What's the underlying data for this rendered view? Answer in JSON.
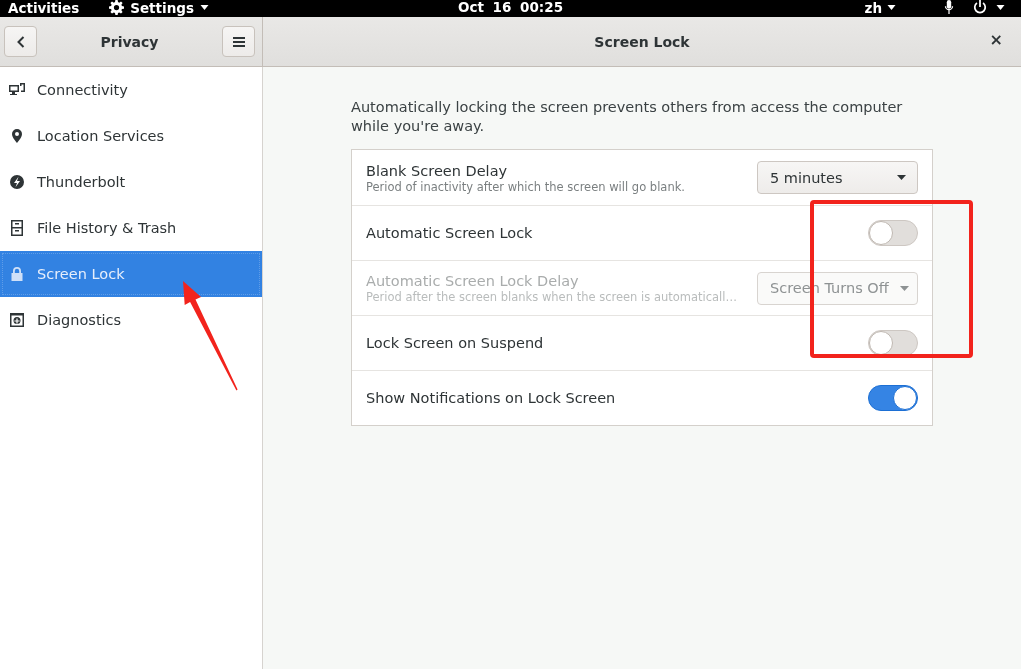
{
  "top_bar": {
    "activities": "Activities",
    "app_menu": "Settings",
    "clock": "Oct 16 00:25",
    "input_source": "zh"
  },
  "sidebar": {
    "title": "Privacy",
    "items": [
      {
        "label": "Connectivity",
        "selected": false
      },
      {
        "label": "Location Services",
        "selected": false
      },
      {
        "label": "Thunderbolt",
        "selected": false
      },
      {
        "label": "File History & Trash",
        "selected": false
      },
      {
        "label": "Screen Lock",
        "selected": true
      },
      {
        "label": "Diagnostics",
        "selected": false
      }
    ]
  },
  "panel": {
    "title": "Screen Lock",
    "close": "×",
    "description": "Automatically locking the screen prevents others from access the computer while you're away.",
    "rows": [
      {
        "kind": "dropdown",
        "title": "Blank Screen Delay",
        "subtitle": "Period of inactivity after which the screen will go blank.",
        "value": "5 minutes",
        "disabled": false
      },
      {
        "kind": "switch",
        "title": "Automatic Screen Lock",
        "on": false,
        "disabled": false
      },
      {
        "kind": "dropdown",
        "title": "Automatic Screen Lock Delay",
        "subtitle": "Period after the screen blanks when the screen is automaticall…",
        "value": "Screen Turns Off",
        "disabled": true
      },
      {
        "kind": "switch",
        "title": "Lock Screen on Suspend",
        "on": false,
        "disabled": false
      },
      {
        "kind": "switch",
        "title": "Show Notifications on Lock Screen",
        "on": true,
        "disabled": false
      }
    ]
  }
}
